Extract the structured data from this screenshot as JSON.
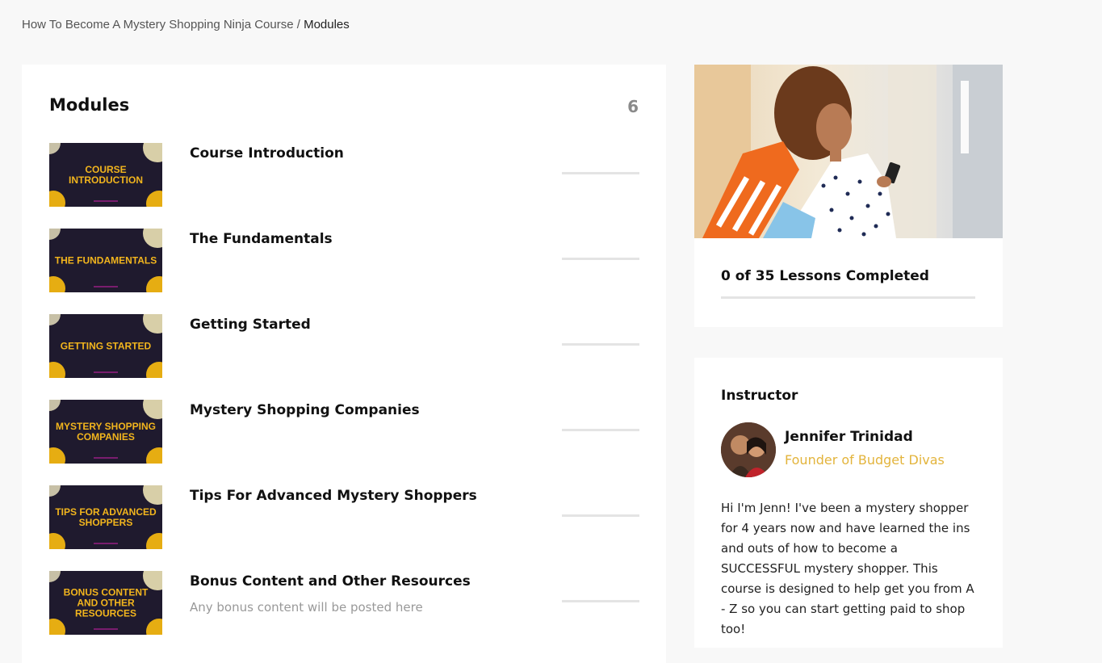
{
  "breadcrumb": {
    "course": "How To Become A Mystery Shopping Ninja Course",
    "separator": " / ",
    "current": "Modules"
  },
  "modules": {
    "title": "Modules",
    "count": "6",
    "items": [
      {
        "thumb_text": "COURSE INTRODUCTION",
        "title": "Course Introduction",
        "subtitle": "",
        "progress": 0
      },
      {
        "thumb_text": "THE FUNDAMENTALS",
        "title": "The Fundamentals",
        "subtitle": "",
        "progress": 0
      },
      {
        "thumb_text": "GETTING STARTED",
        "title": "Getting Started",
        "subtitle": "",
        "progress": 0
      },
      {
        "thumb_text": "MYSTERY SHOPPING COMPANIES",
        "title": "Mystery Shopping Companies",
        "subtitle": "",
        "progress": 0
      },
      {
        "thumb_text": "TIPS FOR ADVANCED SHOPPERS",
        "title": "Tips For Advanced Mystery Shoppers",
        "subtitle": "",
        "progress": 0
      },
      {
        "thumb_text": "BONUS CONTENT AND OTHER RESOURCES",
        "title": "Bonus Content and Other Resources",
        "subtitle": "Any bonus content will be posted here",
        "progress": 0
      }
    ]
  },
  "progress": {
    "label": "0 of 35 Lessons Completed",
    "fraction": 0
  },
  "instructor": {
    "heading": "Instructor",
    "name": "Jennifer Trinidad",
    "role": "Founder of Budget Divas",
    "bio": "Hi I'm Jenn! I've been a mystery shopper for 4 years now and have learned the ins and outs of how to become a SUCCESSFUL mystery shopper. This course is designed to help get you from A - Z so you can start getting paid to shop too!"
  },
  "colors": {
    "accent": "#e3b43c",
    "thumb_bg": "#1f1a2e",
    "thumb_text": "#f2b51d"
  }
}
